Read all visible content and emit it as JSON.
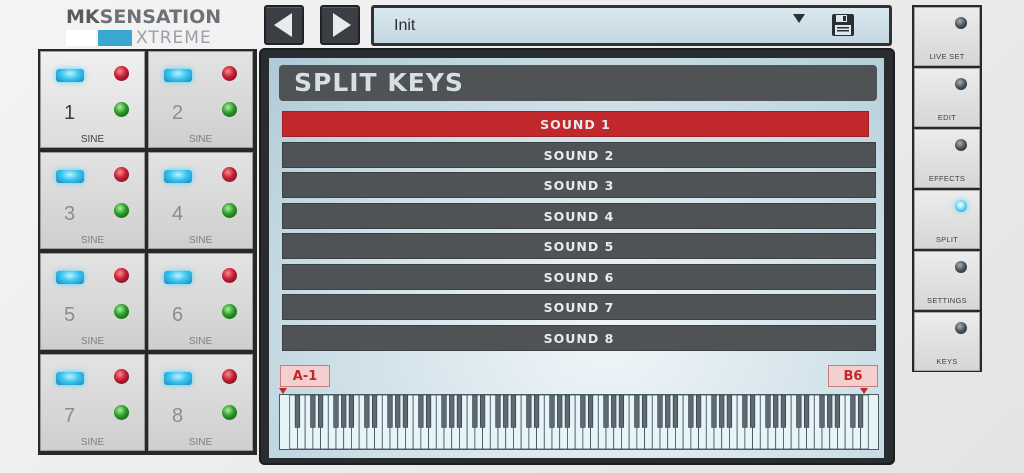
{
  "logo": {
    "brand_prefix": "MK",
    "brand_main": "SENSATION",
    "edition": "XTREME"
  },
  "toolbar": {
    "prev_icon": "triangle-left",
    "next_icon": "triangle-right"
  },
  "preset": {
    "name": "Init",
    "dropdown_icon": "caret-down",
    "save_icon": "floppy-disk"
  },
  "slots": [
    {
      "number": "1",
      "type": "SINE",
      "active": true
    },
    {
      "number": "2",
      "type": "SINE",
      "active": false
    },
    {
      "number": "3",
      "type": "SINE",
      "active": false
    },
    {
      "number": "4",
      "type": "SINE",
      "active": false
    },
    {
      "number": "5",
      "type": "SINE",
      "active": false
    },
    {
      "number": "6",
      "type": "SINE",
      "active": false
    },
    {
      "number": "7",
      "type": "SINE",
      "active": false
    },
    {
      "number": "8",
      "type": "SINE",
      "active": false
    }
  ],
  "split": {
    "title": "SPLIT KEYS",
    "sounds": [
      "SOUND 1",
      "SOUND 2",
      "SOUND 3",
      "SOUND 4",
      "SOUND 5",
      "SOUND 6",
      "SOUND 7",
      "SOUND 8"
    ],
    "selected_sound": "SOUND 1",
    "range_low": "A-1",
    "range_high": "B6"
  },
  "side_nav": [
    {
      "label": "LIVE SET",
      "active": false
    },
    {
      "label": "EDIT",
      "active": false
    },
    {
      "label": "EFFECTS",
      "active": false
    },
    {
      "label": "SPLIT",
      "active": true
    },
    {
      "label": "SETTINGS",
      "active": false
    },
    {
      "label": "KEYS",
      "active": false
    }
  ],
  "colors": {
    "accent_red": "#c0282b",
    "led_blue": "#3ac6f0",
    "panel_dark": "#4f5356",
    "screen_bg": "#cfe0e8"
  }
}
